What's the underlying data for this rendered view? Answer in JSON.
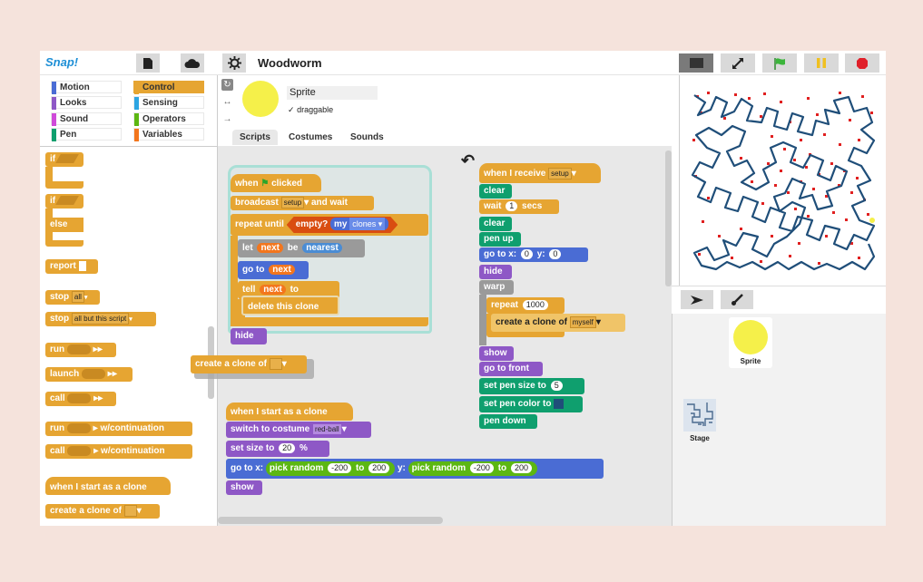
{
  "app": {
    "logo": "Snap!",
    "project_title": "Woodworm"
  },
  "toolbar": {
    "icons": [
      "file-icon",
      "cloud-icon",
      "gear-icon"
    ],
    "stage_icons": [
      "stage-size-icon",
      "fullscreen-icon",
      "green-flag-icon",
      "pause-icon",
      "stop-icon"
    ]
  },
  "categories": [
    {
      "label": "Motion",
      "color": "#4a6cd4"
    },
    {
      "label": "Looks",
      "color": "#8e58c6"
    },
    {
      "label": "Sound",
      "color": "#cf4ad9"
    },
    {
      "label": "Pen",
      "color": "#0f9f6e"
    },
    {
      "label": "Control",
      "color": "#e6a532"
    },
    {
      "label": "Sensing",
      "color": "#2ca5e2"
    },
    {
      "label": "Operators",
      "color": "#5cb712"
    },
    {
      "label": "Variables",
      "color": "#f3761d"
    }
  ],
  "palette": {
    "if": "if",
    "if2": "if",
    "else": "else",
    "report": "report",
    "stop": "stop",
    "stop_opt": "all",
    "stop2": "stop",
    "stop2_opt": "all but this script",
    "run": "run",
    "launch": "launch",
    "call": "call",
    "run_cont": "run",
    "run_cont2": "w/continuation",
    "call_cont": "call",
    "call_cont2": "w/continuation",
    "when_clone": "when I start as a clone",
    "create_clone": "create a clone of"
  },
  "sprite": {
    "name": "Sprite",
    "draggable_label": "draggable",
    "draggable_check": "✓"
  },
  "tabs": [
    "Scripts",
    "Costumes",
    "Sounds"
  ],
  "script1": {
    "when": "when",
    "clicked": "clicked",
    "broadcast": "broadcast",
    "setup": "setup",
    "and_wait": "and wait",
    "repeat_until": "repeat until",
    "empty": "empty?",
    "my": "my",
    "clones": "clones",
    "let": "let",
    "next": "next",
    "be": "be",
    "nearest": "nearest",
    "go_to": "go to",
    "tell": "tell",
    "to": "to",
    "delete_clone": "delete this clone",
    "hide": "hide"
  },
  "floating": {
    "create_clone": "create a clone of"
  },
  "script2": {
    "when_receive": "when I receive",
    "setup": "setup",
    "clear": "clear",
    "wait": "wait",
    "wait_val": "1",
    "secs": "secs",
    "clear2": "clear",
    "pen_up": "pen up",
    "go_to_x": "go to x:",
    "x_val": "0",
    "y": "y:",
    "y_val": "0",
    "hide": "hide",
    "warp": "warp",
    "repeat": "repeat",
    "repeat_val": "1000",
    "create_clone": "create a clone of",
    "myself": "myself",
    "show": "show",
    "go_front": "go to front",
    "set_pen_size": "set pen size to",
    "pen_size_val": "5",
    "set_pen_color": "set pen color to",
    "pen_down": "pen down"
  },
  "script3": {
    "when_clone": "when I start as a clone",
    "switch_costume": "switch to costume",
    "costume": "red-ball",
    "set_size": "set size to",
    "size_val": "20",
    "pct": "%",
    "go_to_x": "go to x:",
    "pick_random": "pick random",
    "neg200": "-200",
    "to": "to",
    "p200": "200",
    "y": "y:",
    "pick_random2": "pick random",
    "neg200b": "-200",
    "to2": "to",
    "p200b": "200",
    "show": "show"
  },
  "corral": {
    "sprite_label": "Sprite",
    "stage_label": "Stage"
  },
  "colors": {
    "control": "#e6a532",
    "motion": "#4a6cd4",
    "looks": "#8e58c6",
    "pen": "#0f9f6e",
    "variables": "#f3761d",
    "operators": "#5cb712",
    "lists": "#d94d11",
    "maze": "#1f4e79",
    "dots": "#e02020"
  }
}
